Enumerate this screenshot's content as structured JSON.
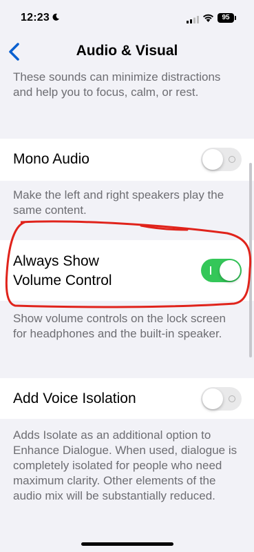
{
  "status_bar": {
    "time": "12:23",
    "focus_icon": "moon-icon",
    "signal_icon": "cellular-signal-icon",
    "wifi_icon": "wifi-icon",
    "battery_level": "95"
  },
  "nav": {
    "back_icon": "chevron-left-icon",
    "title": "Audio & Visual"
  },
  "sections": {
    "top_footer": "These sounds can minimize distractions and help you to focus, calm, or rest.",
    "mono_audio": {
      "label": "Mono Audio",
      "state": "off",
      "footer": "Make the left and right speakers play the same content."
    },
    "volume_control": {
      "label": "Always Show Volume Control",
      "state": "on",
      "footer": "Show volume controls on the lock screen for headphones and the built-in speaker."
    },
    "voice_isolation": {
      "label": "Add Voice Isolation",
      "state": "off",
      "footer": "Adds Isolate as an additional option to Enhance Dialogue. When used, dialogue is completely isolated for people who need maximum clarity. Other elements of the audio mix will be substantially reduced."
    }
  },
  "colors": {
    "accent": "#0a60d0",
    "toggle_on": "#34c759",
    "toggle_off": "#e9e9ea",
    "background": "#f2f2f7",
    "annotation": "#e0231b"
  }
}
